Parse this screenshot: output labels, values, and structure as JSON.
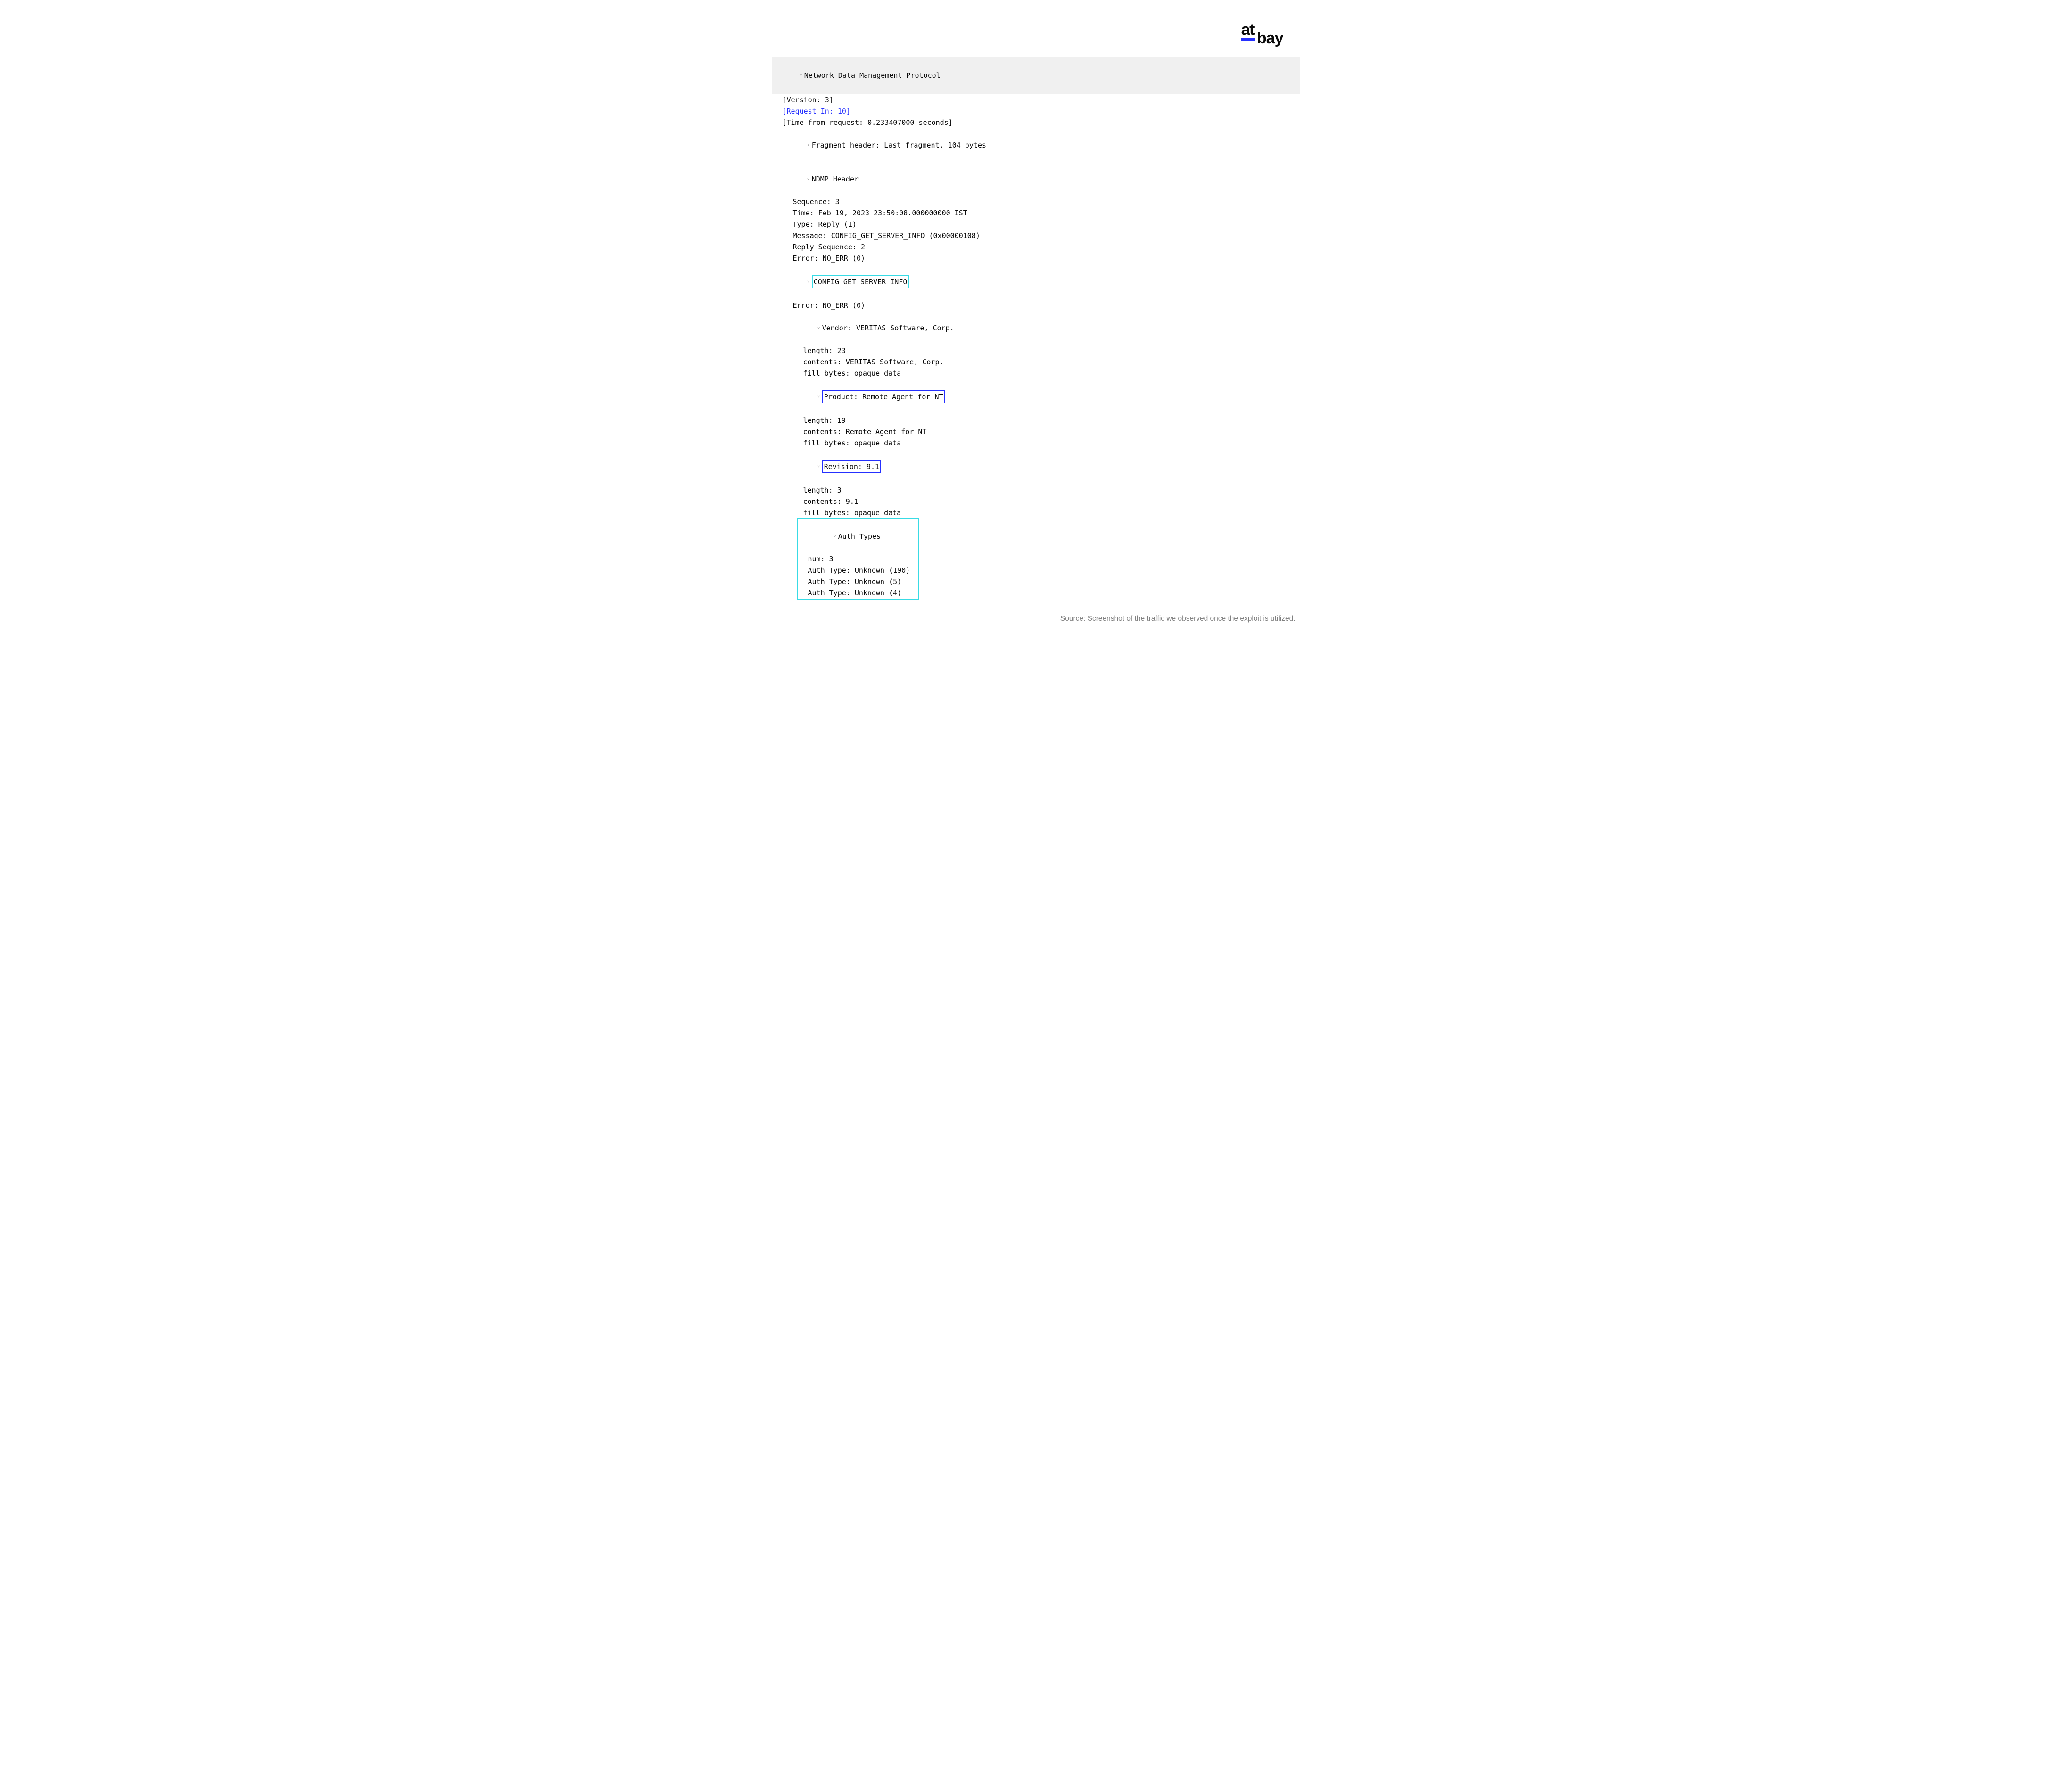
{
  "logo": {
    "part1": "at",
    "part2": "bay"
  },
  "tree": {
    "root_label": "Network Data Management Protocol",
    "version": "[Version: 3]",
    "request_in": "[Request In: 10]",
    "time_from_request": "[Time from request: 0.233407000 seconds]",
    "fragment_header": "Fragment header: Last fragment, 104 bytes",
    "ndmp_header_label": "NDMP Header",
    "ndmp_header": {
      "sequence": "Sequence: 3",
      "time": "Time: Feb 19, 2023 23:50:08.000000000 IST",
      "type": "Type: Reply (1)",
      "message": "Message: CONFIG_GET_SERVER_INFO (0x00000108)",
      "reply_sequence": "Reply Sequence: 2",
      "error": "Error: NO_ERR (0)"
    },
    "config_label": "CONFIG_GET_SERVER_INFO",
    "config": {
      "error": "Error: NO_ERR (0)",
      "vendor_label": "Vendor: VERITAS Software, Corp.",
      "vendor": {
        "length": "length: 23",
        "contents": "contents: VERITAS Software, Corp.",
        "fill": "fill bytes: opaque data"
      },
      "product_label": "Product: Remote Agent for NT",
      "product": {
        "length": "length: 19",
        "contents": "contents: Remote Agent for NT",
        "fill": "fill bytes: opaque data"
      },
      "revision_label": "Revision: 9.1",
      "revision": {
        "length": "length: 3",
        "contents": "contents: 9.1",
        "fill": "fill bytes: opaque data"
      },
      "auth_label": "Auth Types",
      "auth": {
        "num": "num: 3",
        "t1": "Auth Type: Unknown (190)",
        "t2": "Auth Type: Unknown (5)",
        "t3": "Auth Type: Unknown (4)"
      }
    }
  },
  "caption": "Source: Screenshot of the traffic we observed once the exploit is utilized."
}
